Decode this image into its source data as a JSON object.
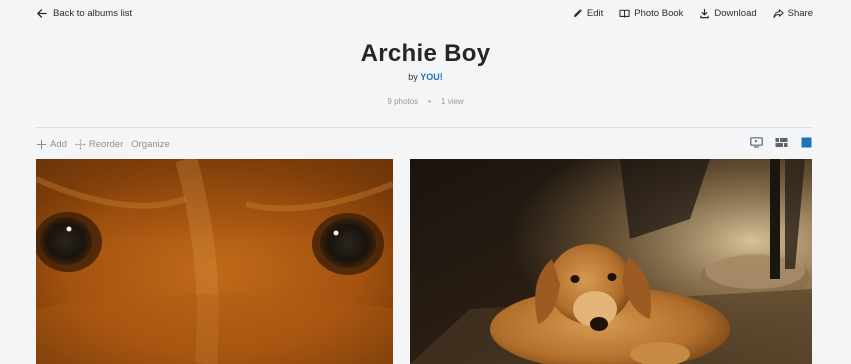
{
  "nav": {
    "back_label": "Back to albums list",
    "actions": [
      {
        "label": "Edit",
        "icon": "pencil-icon"
      },
      {
        "label": "Photo Book",
        "icon": "book-icon"
      },
      {
        "label": "Download",
        "icon": "download-icon"
      },
      {
        "label": "Share",
        "icon": "share-icon"
      }
    ]
  },
  "album": {
    "title": "Archie Boy",
    "by_prefix": "by",
    "owner": "YOU!",
    "photo_count": "9 photos",
    "separator": "•",
    "view_count": "1 view"
  },
  "toolbar": {
    "add_label": "Add",
    "reorder_label": "Reorder",
    "organize_label": "Organize"
  },
  "view_modes": [
    {
      "icon": "slideshow-icon",
      "active": false
    },
    {
      "icon": "grid-icon",
      "active": false
    },
    {
      "icon": "single-view-icon",
      "active": true
    }
  ],
  "photos": [
    {
      "subject": "close-up of dog eyes"
    },
    {
      "subject": "golden retriever lying on floor"
    }
  ],
  "colors": {
    "background": "#f3f5f7",
    "accent": "#1f72b8",
    "muted": "#8f8f8f"
  }
}
